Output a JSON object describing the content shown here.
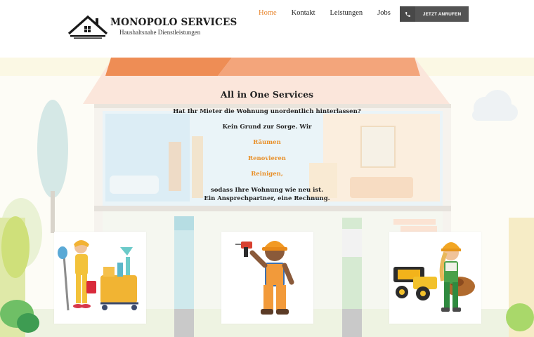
{
  "brand": {
    "name": "MONOPOLO SERVICES",
    "tagline": "Haushaltsnahe Dienstleistungen"
  },
  "nav": {
    "items": [
      "Home",
      "Kontakt",
      "Leistungen",
      "Jobs"
    ],
    "active": "Home"
  },
  "cta": {
    "label": "JETZT ANRUFEN",
    "icon": "phone-icon"
  },
  "hero": {
    "title": "All in One Services",
    "line1": "Hat Ihr Mieter die Wohnung unordentlich hinterlassen?",
    "line2": "Kein Grund zur Sorge. Wir",
    "services": [
      "Räumen",
      "Renovieren",
      "Reinigen,"
    ],
    "line3": "sodass Ihre Wohnung wie neu ist.",
    "line4": "Ein Ansprechpartner, eine Rechnung."
  },
  "cards": [
    {
      "icon": "cleaning-worker-icon"
    },
    {
      "icon": "renovation-worker-icon"
    },
    {
      "icon": "clearance-worker-icon"
    }
  ],
  "colors": {
    "accent": "#e8862f",
    "roof": "#f28a5a",
    "cta_bg": "#545454"
  }
}
